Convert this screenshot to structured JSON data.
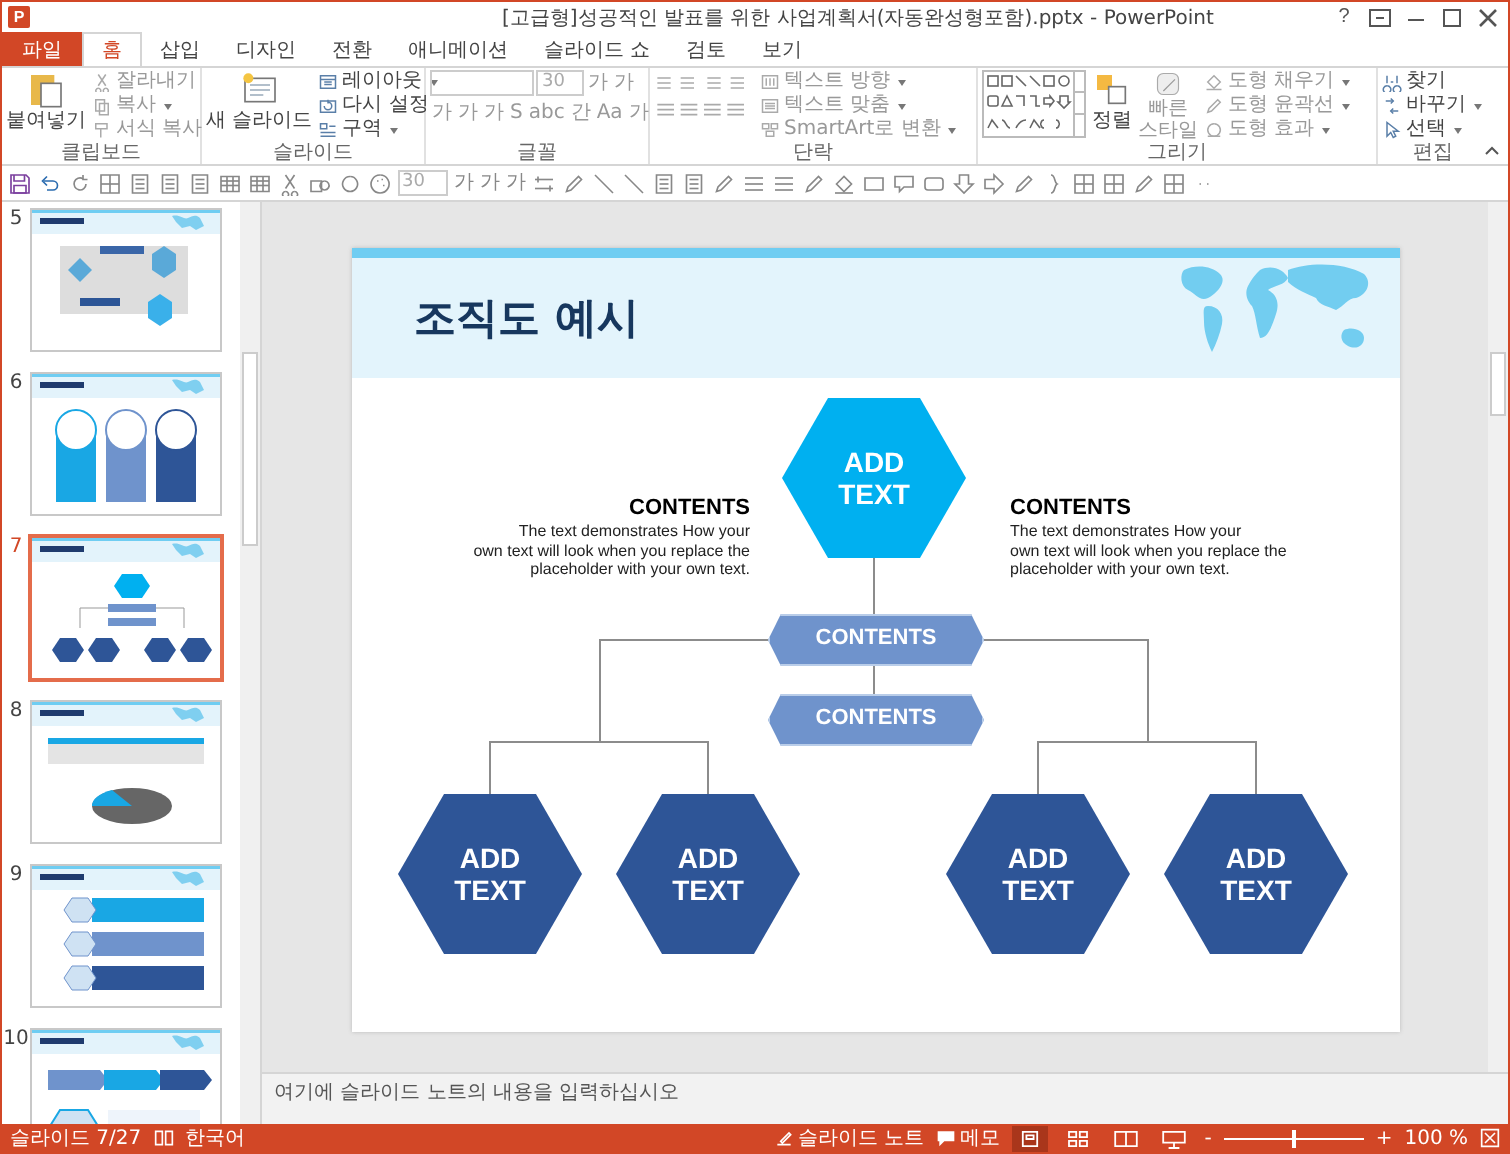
{
  "window": {
    "logo": "P",
    "title": "[고급형]성공적인 발표를 위한 사업계획서(자동완성형포함).pptx - PowerPoint",
    "help": "?"
  },
  "tabs": [
    {
      "label": "파일",
      "kind": "file",
      "selected": false
    },
    {
      "label": "홈",
      "kind": "tab",
      "selected": true
    },
    {
      "label": "삽입",
      "kind": "tab",
      "selected": false
    },
    {
      "label": "디자인",
      "kind": "tab",
      "selected": false
    },
    {
      "label": "전환",
      "kind": "tab",
      "selected": false
    },
    {
      "label": "애니메이션",
      "kind": "tab",
      "selected": false
    },
    {
      "label": "슬라이드 쇼",
      "kind": "tab",
      "selected": false
    },
    {
      "label": "검토",
      "kind": "tab",
      "selected": false
    },
    {
      "label": "보기",
      "kind": "tab",
      "selected": false
    }
  ],
  "ribbon": {
    "clipboard": {
      "label": "클립보드",
      "paste": "붙여넣기",
      "items": [
        {
          "label": "잘라내기",
          "disabled": true,
          "dropdown": false
        },
        {
          "label": "복사",
          "disabled": true,
          "dropdown": true
        },
        {
          "label": "서식 복사",
          "disabled": true,
          "dropdown": false
        }
      ]
    },
    "slides": {
      "label": "슬라이드",
      "new_slide": "새 슬라이드",
      "items": [
        {
          "label": "레이아웃",
          "disabled": false,
          "dropdown": true
        },
        {
          "label": "다시 설정",
          "disabled": false,
          "dropdown": false
        },
        {
          "label": "구역",
          "disabled": false,
          "dropdown": true
        }
      ]
    },
    "font": {
      "label": "글꼴",
      "size": "30",
      "size_buttons": [
        "가",
        "가"
      ],
      "format_buttons": [
        "가",
        "가",
        "가",
        "S",
        "abc",
        "간",
        "Aa",
        "가"
      ]
    },
    "paragraph": {
      "label": "단락",
      "items": [
        {
          "label": "텍스트 방향",
          "disabled": true,
          "dropdown": true
        },
        {
          "label": "텍스트 맞춤",
          "disabled": true,
          "dropdown": true
        },
        {
          "label": "SmartArt로 변환",
          "disabled": true,
          "dropdown": true
        }
      ]
    },
    "drawing": {
      "label": "그리기",
      "arrange": "정렬",
      "quick_style": [
        "빠른",
        "스타일"
      ],
      "items": [
        {
          "label": "도형 채우기",
          "disabled": true,
          "dropdown": true
        },
        {
          "label": "도형 윤곽선",
          "disabled": true,
          "dropdown": true
        },
        {
          "label": "도형 효과",
          "disabled": true,
          "dropdown": true
        }
      ]
    },
    "editing": {
      "label": "편집",
      "items": [
        {
          "label": "찾기",
          "disabled": false,
          "dropdown": false
        },
        {
          "label": "바꾸기",
          "disabled": false,
          "dropdown": true
        },
        {
          "label": "선택",
          "disabled": false,
          "dropdown": true
        }
      ]
    }
  },
  "quick_access": [
    {
      "kind": "save"
    },
    {
      "kind": "undo"
    },
    {
      "kind": "redo"
    },
    {
      "kind": "grid"
    },
    {
      "kind": "doc"
    },
    {
      "kind": "doc"
    },
    {
      "kind": "doc"
    },
    {
      "kind": "table"
    },
    {
      "kind": "table"
    },
    {
      "kind": "scissors"
    },
    {
      "kind": "shapes"
    },
    {
      "kind": "circle"
    },
    {
      "kind": "palette"
    },
    {
      "kind": "field",
      "value": "30"
    },
    {
      "kind": "glyph",
      "text": "가"
    },
    {
      "kind": "glyph",
      "text": "가"
    },
    {
      "kind": "glyph",
      "text": "가"
    },
    {
      "kind": "swap"
    },
    {
      "kind": "outline"
    },
    {
      "kind": "line"
    },
    {
      "kind": "line"
    },
    {
      "kind": "doc"
    },
    {
      "kind": "doc"
    },
    {
      "kind": "outline"
    },
    {
      "kind": "lines"
    },
    {
      "kind": "lines"
    },
    {
      "kind": "outline"
    },
    {
      "kind": "fill"
    },
    {
      "kind": "rect"
    },
    {
      "kind": "callout"
    },
    {
      "kind": "rrect"
    },
    {
      "kind": "down"
    },
    {
      "kind": "right"
    },
    {
      "kind": "outline"
    },
    {
      "kind": "brace"
    },
    {
      "kind": "grid"
    },
    {
      "kind": "grid"
    },
    {
      "kind": "outline"
    },
    {
      "kind": "grid"
    },
    {
      "kind": "more"
    }
  ],
  "thumbnails": [
    {
      "number": "5",
      "kind": "map",
      "selected": false
    },
    {
      "number": "6",
      "kind": "timeline",
      "selected": false
    },
    {
      "number": "7",
      "kind": "org",
      "selected": true
    },
    {
      "number": "8",
      "kind": "table-pie",
      "selected": false
    },
    {
      "number": "9",
      "kind": "list",
      "selected": false
    },
    {
      "number": "10",
      "kind": "process",
      "selected": false
    }
  ],
  "slide": {
    "title": "조직도 예시",
    "center_node": [
      "ADD",
      "TEXT"
    ],
    "side_texts": [
      {
        "heading": "CONTENTS",
        "lines": [
          "The text demonstrates How your",
          "own text will look when you replace the",
          "placeholder with your own text."
        ]
      },
      {
        "heading": "CONTENTS",
        "lines": [
          "The text demonstrates How your",
          "own text will look when you replace the",
          "placeholder with your own text."
        ]
      }
    ],
    "bars": [
      "CONTENTS",
      "CONTENTS"
    ],
    "leaves": [
      [
        "ADD",
        "TEXT"
      ],
      [
        "ADD",
        "TEXT"
      ],
      [
        "ADD",
        "TEXT"
      ],
      [
        "ADD",
        "TEXT"
      ]
    ]
  },
  "notes": {
    "placeholder": "여기에 슬라이드 노트의 내용을 입력하십시오"
  },
  "status_bar": {
    "slide": "슬라이드 7/27",
    "language": "한국어",
    "notes": "슬라이드 노트",
    "comments": "메모",
    "views": [
      {
        "kind": "normal",
        "selected": true
      },
      {
        "kind": "sorter",
        "selected": false
      },
      {
        "kind": "reading",
        "selected": false
      },
      {
        "kind": "show",
        "selected": false
      }
    ],
    "zoom": {
      "level": 0.5,
      "minus": "-",
      "plus": "+",
      "reading": "100 %"
    }
  }
}
